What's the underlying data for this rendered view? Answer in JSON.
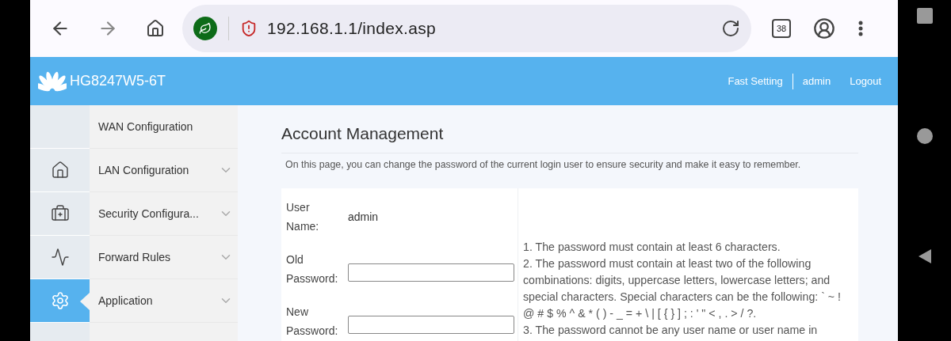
{
  "browser": {
    "url": "192.168.1.1/index.asp",
    "tab_count": "38"
  },
  "header": {
    "product": "HG8247W5-6T",
    "links": [
      "Fast Setting",
      "admin",
      "Logout"
    ]
  },
  "nav_icons": [
    {
      "kind": "blank",
      "selected": false
    },
    {
      "kind": "home",
      "selected": false
    },
    {
      "kind": "kit",
      "selected": false
    },
    {
      "kind": "pulse",
      "selected": false
    },
    {
      "kind": "gear",
      "selected": true
    }
  ],
  "menu": [
    {
      "label": "WAN Configuration",
      "expandable": false
    },
    {
      "label": "LAN Configuration",
      "expandable": true
    },
    {
      "label": "Security Configura...",
      "expandable": true
    },
    {
      "label": "Forward Rules",
      "expandable": true
    },
    {
      "label": "Application",
      "expandable": true
    }
  ],
  "page": {
    "title": "Account Management",
    "description": "On this page, you can change the password of the current login user to ensure security and make it easy to remember.",
    "fields": [
      {
        "label": "User Name:",
        "kind": "text",
        "value": "admin"
      },
      {
        "label": "Old Password:",
        "kind": "input"
      },
      {
        "label": "New Password:",
        "kind": "input"
      }
    ],
    "rules": [
      "1. The password must contain at least 6 characters.",
      "2. The password must contain at least two of the following combinations: digits, uppercase letters, lowercase letters; and special characters. Special characters can be the following: ` ~ ! @ # $ % ^ & * ( ) - _ = + \\ | [ { } ] ; : ' \" < , . > / ?.",
      "3. The password cannot be any user name or user name in"
    ]
  }
}
